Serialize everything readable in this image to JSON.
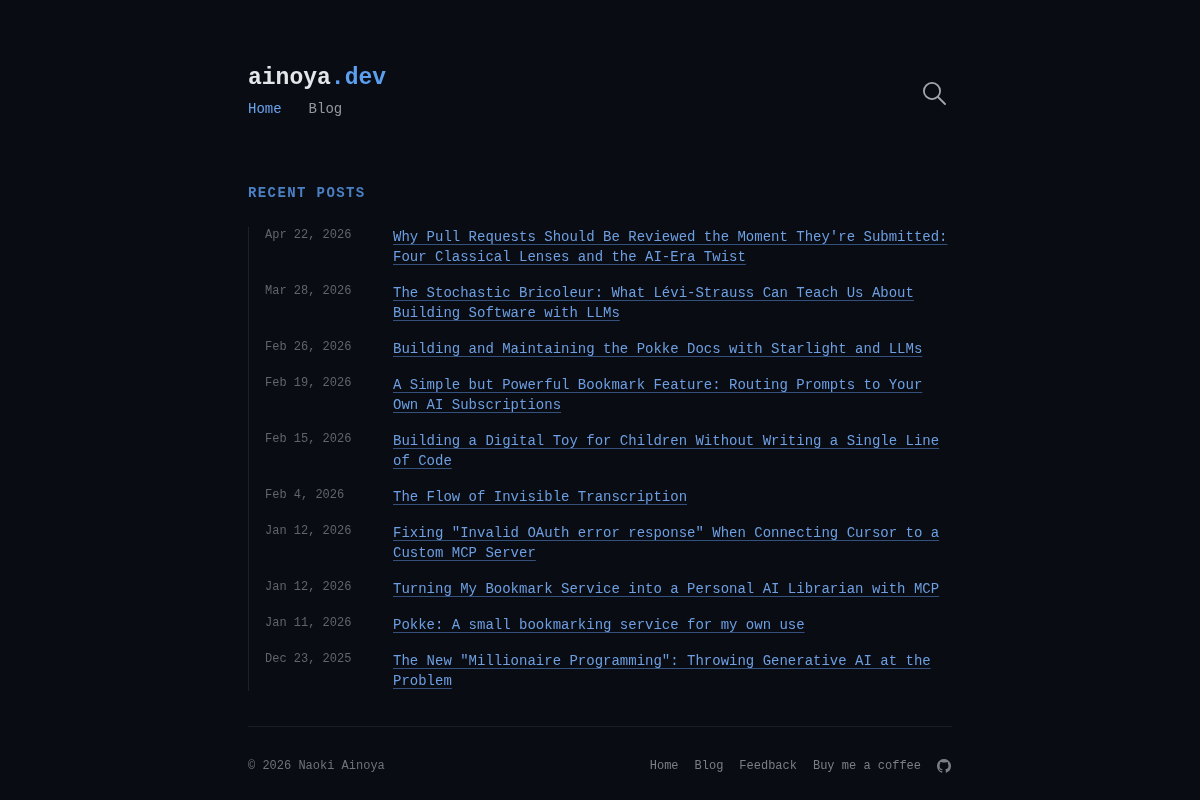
{
  "logo": {
    "name": "ainoya",
    "suffix": ".dev"
  },
  "nav": [
    {
      "label": "Home",
      "selected": true
    },
    {
      "label": "Blog",
      "selected": false
    }
  ],
  "section_title": "RECENT POSTS",
  "posts": [
    {
      "date": "Apr 22, 2026",
      "title": "Why Pull Requests Should Be Reviewed the Moment They're Submitted: Four Classical Lenses and the AI-Era Twist"
    },
    {
      "date": "Mar 28, 2026",
      "title": "The Stochastic Bricoleur: What Lévi-Strauss Can Teach Us About Building Software with LLMs"
    },
    {
      "date": "Feb 26, 2026",
      "title": "Building and Maintaining the Pokke Docs with Starlight and LLMs"
    },
    {
      "date": "Feb 19, 2026",
      "title": "A Simple but Powerful Bookmark Feature: Routing Prompts to Your Own AI Subscriptions"
    },
    {
      "date": "Feb 15, 2026",
      "title": "Building a Digital Toy for Children Without Writing a Single Line of Code"
    },
    {
      "date": "Feb 4, 2026",
      "title": "The Flow of Invisible Transcription"
    },
    {
      "date": "Jan 12, 2026",
      "title": "Fixing \"Invalid OAuth error response\" When Connecting Cursor to a Custom MCP Server"
    },
    {
      "date": "Jan 12, 2026",
      "title": "Turning My Bookmark Service into a Personal AI Librarian with MCP"
    },
    {
      "date": "Jan 11, 2026",
      "title": "Pokke: A small bookmarking service for my own use"
    },
    {
      "date": "Dec 23, 2025",
      "title": "The New \"Millionaire Programming\": Throwing Generative AI at the Problem"
    }
  ],
  "footer": {
    "copyright": "© 2026 Naoki Ainoya",
    "links": [
      "Home",
      "Blog",
      "Feedback",
      "Buy me a coffee"
    ]
  }
}
